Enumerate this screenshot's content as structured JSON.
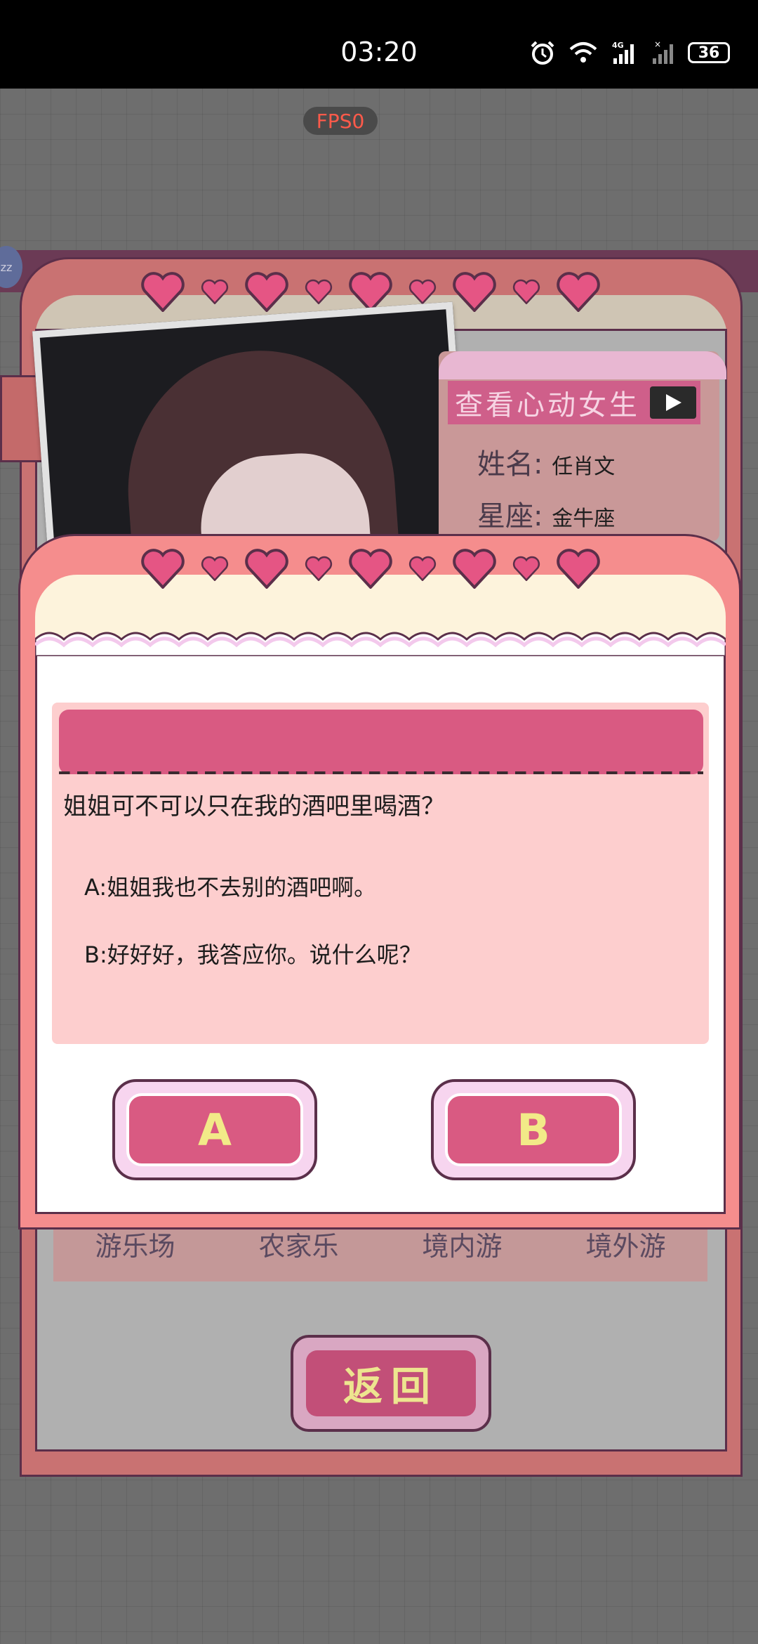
{
  "status_bar": {
    "time": "03:20",
    "battery": "36",
    "icons": [
      "alarm-icon",
      "wifi-icon",
      "signal-4g-icon",
      "signal-icon",
      "battery-icon"
    ]
  },
  "fps": "FPS0",
  "profile": {
    "header": "查看心动女生",
    "name_label": "姓名",
    "name_value": "任肖文",
    "zodiac_label": "星座",
    "zodiac_value": "金牛座",
    "menu_items": [
      "游乐场",
      "农家乐",
      "境内游",
      "境外游"
    ],
    "back_label": "返回"
  },
  "dialog": {
    "question": "姐姐可不可以只在我的酒吧里喝酒？",
    "option_a": "A:姐姐我也不去别的酒吧啊。",
    "option_b": "B:好好好，我答应你。说什么呢？",
    "button_a": "A",
    "button_b": "B"
  },
  "colors": {
    "accent_pink": "#d95a82",
    "button_text": "#f2ea88",
    "dialog_frame": "#f58d8d",
    "question_bg": "#fdcece"
  }
}
